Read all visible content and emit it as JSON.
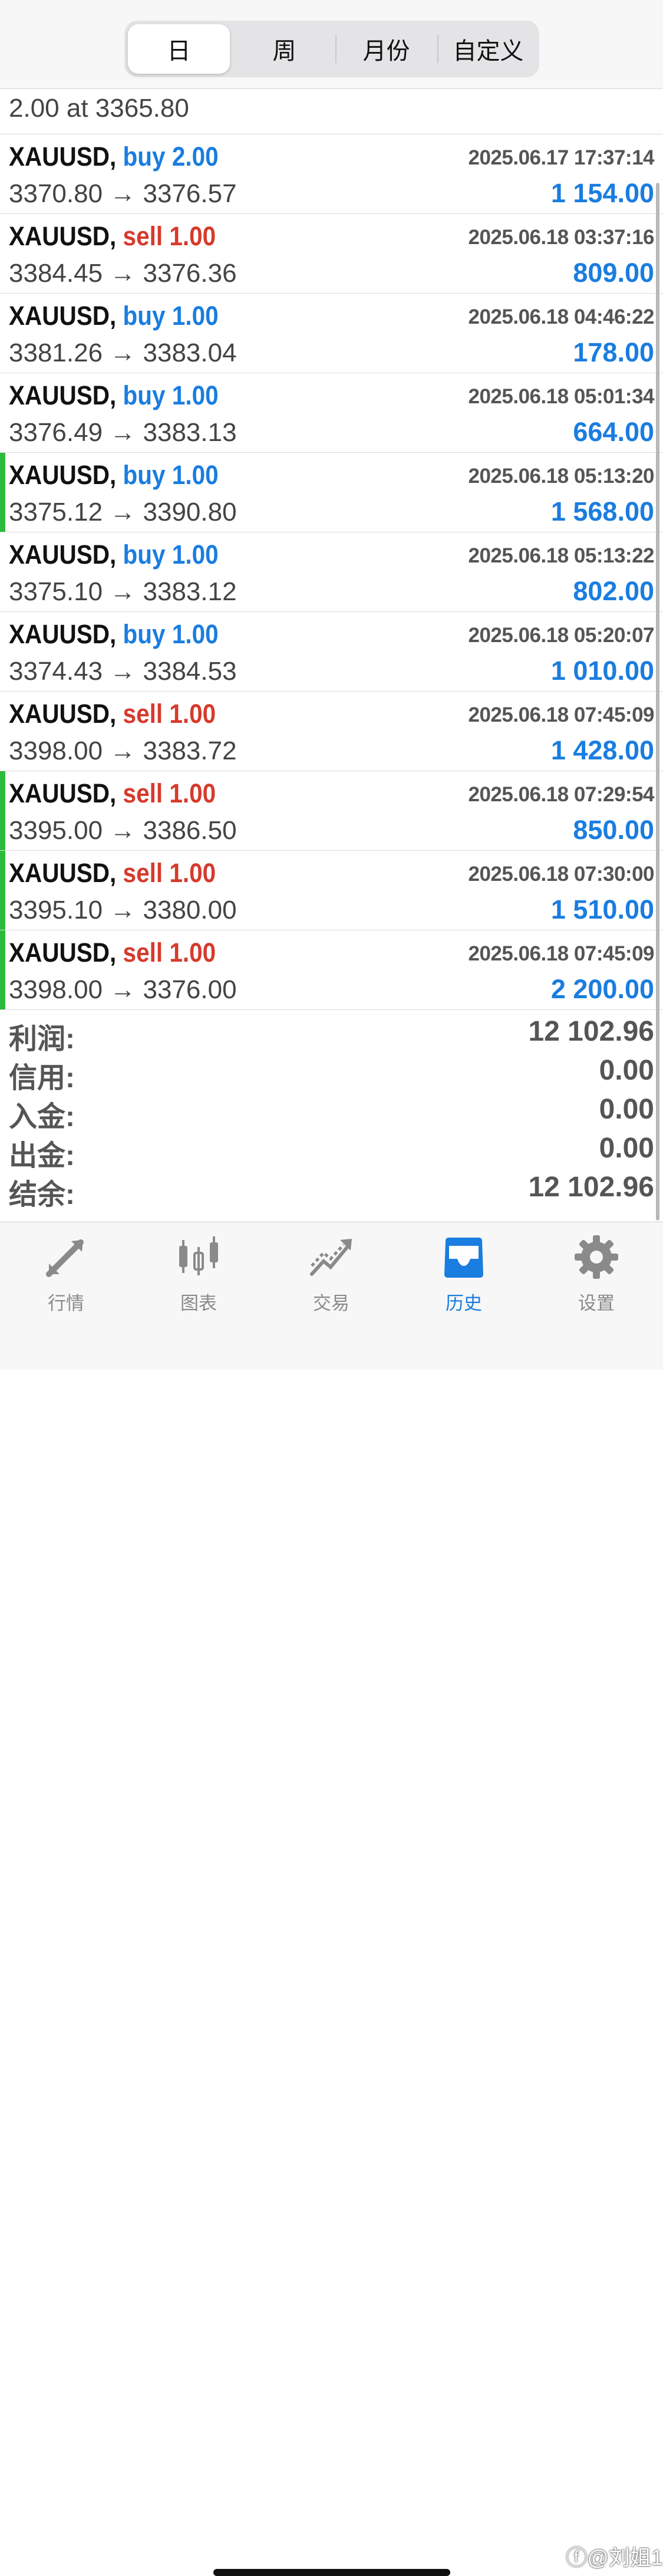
{
  "segmented": [
    "日",
    "周",
    "月份",
    "自定义"
  ],
  "partial_row": "2.00 at 3365.80",
  "trades": [
    {
      "symbol": "XAUUSD,",
      "side": "buy",
      "volume": "2.00",
      "time": "2025.06.17 17:37:14",
      "prices": "3370.80 → 3376.57",
      "profit": "1 154.00",
      "marked": false
    },
    {
      "symbol": "XAUUSD,",
      "side": "sell",
      "volume": "1.00",
      "time": "2025.06.18 03:37:16",
      "prices": "3384.45 → 3376.36",
      "profit": "809.00",
      "marked": false
    },
    {
      "symbol": "XAUUSD,",
      "side": "buy",
      "volume": "1.00",
      "time": "2025.06.18 04:46:22",
      "prices": "3381.26 → 3383.04",
      "profit": "178.00",
      "marked": false
    },
    {
      "symbol": "XAUUSD,",
      "side": "buy",
      "volume": "1.00",
      "time": "2025.06.18 05:01:34",
      "prices": "3376.49 → 3383.13",
      "profit": "664.00",
      "marked": false
    },
    {
      "symbol": "XAUUSD,",
      "side": "buy",
      "volume": "1.00",
      "time": "2025.06.18 05:13:20",
      "prices": "3375.12 → 3390.80",
      "profit": "1 568.00",
      "marked": true
    },
    {
      "symbol": "XAUUSD,",
      "side": "buy",
      "volume": "1.00",
      "time": "2025.06.18 05:13:22",
      "prices": "3375.10 → 3383.12",
      "profit": "802.00",
      "marked": false
    },
    {
      "symbol": "XAUUSD,",
      "side": "buy",
      "volume": "1.00",
      "time": "2025.06.18 05:20:07",
      "prices": "3374.43 → 3384.53",
      "profit": "1 010.00",
      "marked": false
    },
    {
      "symbol": "XAUUSD,",
      "side": "sell",
      "volume": "1.00",
      "time": "2025.06.18 07:45:09",
      "prices": "3398.00 → 3383.72",
      "profit": "1 428.00",
      "marked": false
    },
    {
      "symbol": "XAUUSD,",
      "side": "sell",
      "volume": "1.00",
      "time": "2025.06.18 07:29:54",
      "prices": "3395.00 → 3386.50",
      "profit": "850.00",
      "marked": true
    },
    {
      "symbol": "XAUUSD,",
      "side": "sell",
      "volume": "1.00",
      "time": "2025.06.18 07:30:00",
      "prices": "3395.10 → 3380.00",
      "profit": "1 510.00",
      "marked": true
    },
    {
      "symbol": "XAUUSD,",
      "side": "sell",
      "volume": "1.00",
      "time": "2025.06.18 07:45:09",
      "prices": "3398.00 → 3376.00",
      "profit": "2 200.00",
      "marked": true
    }
  ],
  "summary": [
    {
      "label": "利润:",
      "value": "12 102.96"
    },
    {
      "label": "信用:",
      "value": "0.00"
    },
    {
      "label": "入金:",
      "value": "0.00"
    },
    {
      "label": "出金:",
      "value": "0.00"
    },
    {
      "label": "结余:",
      "value": "12 102.96"
    }
  ],
  "tabs": [
    {
      "label": "行情",
      "icon": "quotes-icon"
    },
    {
      "label": "图表",
      "icon": "chart-icon"
    },
    {
      "label": "交易",
      "icon": "trade-icon"
    },
    {
      "label": "历史",
      "icon": "history-icon",
      "active": true
    },
    {
      "label": "设置",
      "icon": "settings-icon"
    }
  ],
  "watermark": "ⓕ@刘姐1",
  "colors": {
    "buy": "#1a7de0",
    "sell": "#d63a2c",
    "marker": "#2dbb3c",
    "active_tab": "#1a7de0"
  }
}
